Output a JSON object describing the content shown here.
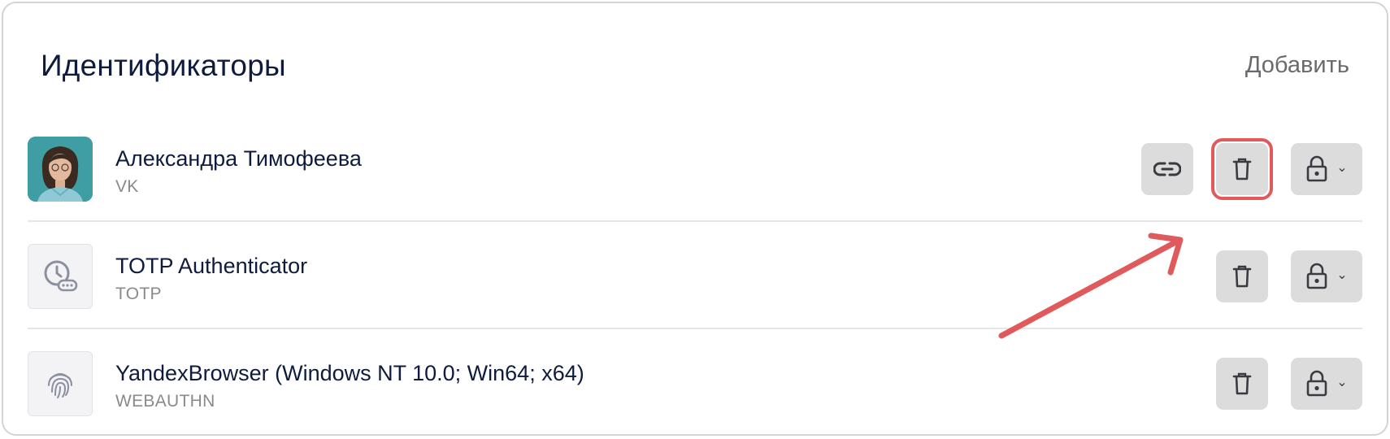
{
  "header": {
    "title": "Идентификаторы",
    "add_label": "Добавить"
  },
  "identifiers": [
    {
      "name": "Александра Тимофеева",
      "type": "VK",
      "icon": "avatar-photo",
      "actions": [
        "link-icon",
        "trash-icon",
        "lock-icon"
      ]
    },
    {
      "name": "TOTP Authenticator",
      "type": "TOTP",
      "icon": "clock-password-icon",
      "actions": [
        "trash-icon",
        "lock-icon"
      ]
    },
    {
      "name": "YandexBrowser (Windows NT 10.0; Win64; x64)",
      "type": "WEBAUTHN",
      "icon": "fingerprint-icon",
      "actions": [
        "trash-icon",
        "lock-icon"
      ]
    }
  ],
  "colors": {
    "title": "#0f1b3d",
    "button_bg": "#dcdcdd",
    "highlight": "#e05a5c",
    "arrow": "#e05a5c"
  }
}
